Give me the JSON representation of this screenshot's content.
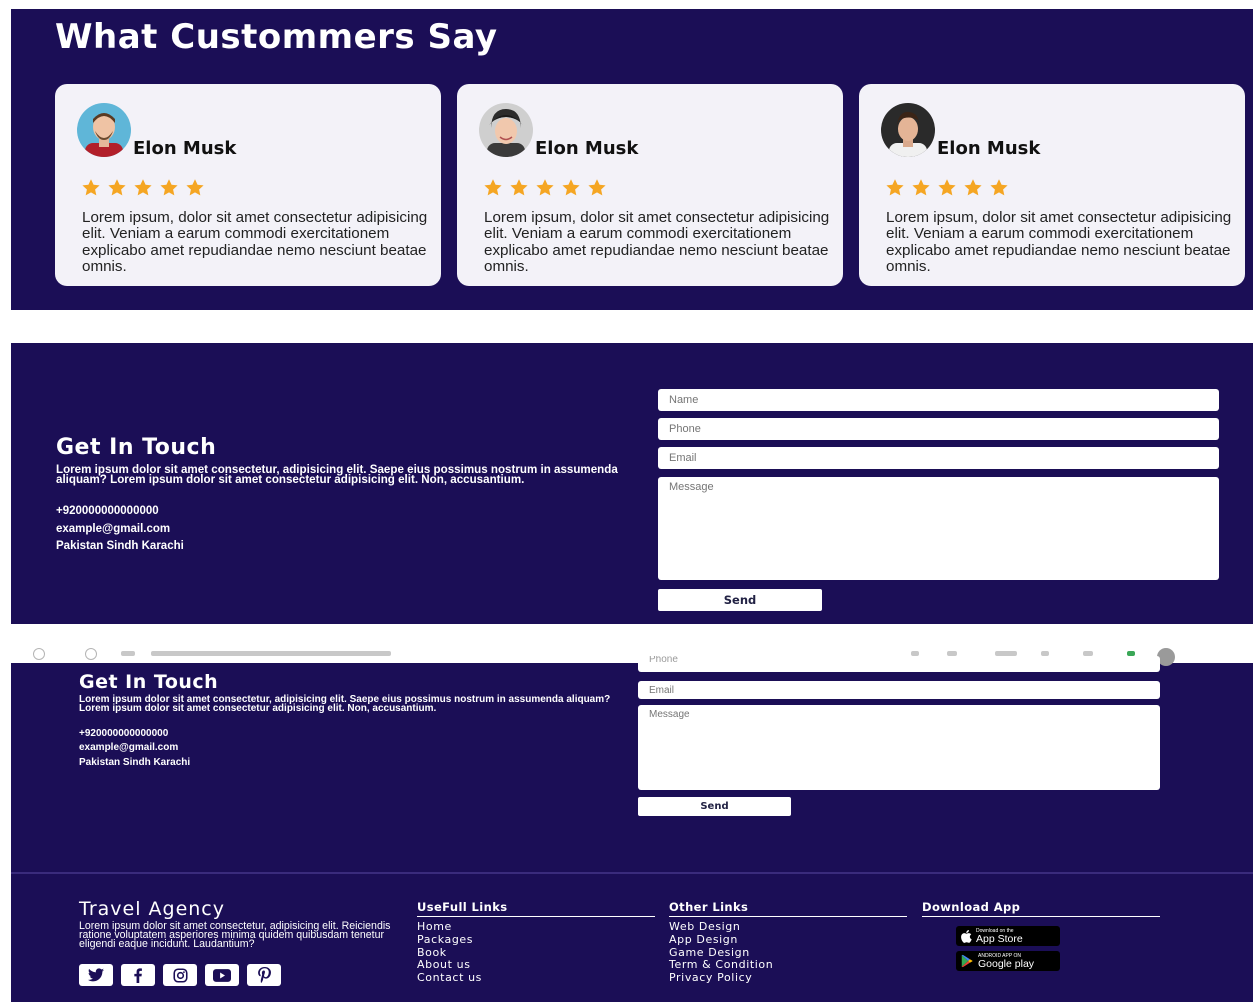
{
  "testimonials": {
    "title": "What Custommers Say",
    "cards": [
      {
        "name": "Elon Musk",
        "rating": 5,
        "text": "Lorem ipsum, dolor sit amet consectetur adipisicing elit. Veniam a earum commodi exercitationem explicabo amet repudiandae nemo nesciunt beatae omnis."
      },
      {
        "name": "Elon Musk",
        "rating": 5,
        "text": "Lorem ipsum, dolor sit amet consectetur adipisicing elit. Veniam a earum commodi exercitationem explicabo amet repudiandae nemo nesciunt beatae omnis."
      },
      {
        "name": "Elon Musk",
        "rating": 5,
        "text": "Lorem ipsum, dolor sit amet consectetur adipisicing elit. Veniam a earum commodi exercitationem explicabo amet repudiandae nemo nesciunt beatae omnis."
      }
    ]
  },
  "contact": {
    "title": "Get In Touch",
    "description": "Lorem ipsum dolor sit amet consectetur, adipisicing elit. Saepe eius possimus nostrum in assumenda aliquam? Lorem ipsum dolor sit amet consectetur adipisicing elit. Non, accusantium.",
    "phone": "+920000000000000",
    "email": "example@gmail.com",
    "address": "Pakistan Sindh Karachi",
    "form": {
      "name_placeholder": "Name",
      "phone_placeholder": "Phone",
      "email_placeholder": "Email",
      "message_placeholder": "Message",
      "send_label": "Send"
    }
  },
  "footer": {
    "brand": "Travel Agency",
    "description": "Lorem ipsum dolor sit amet consectetur, adipisicing elit. Reiciendis ratione voluptatem asperiores minima quidem quibusdam tenetur eligendi eaque incidunt. Laudantium?",
    "socials": [
      "twitter-icon",
      "facebook-icon",
      "instagram-icon",
      "youtube-icon",
      "pinterest-icon"
    ],
    "useful_links": {
      "title": "UseFull Links",
      "items": [
        "Home",
        "Packages",
        "Book",
        "About us",
        "Contact us"
      ]
    },
    "other_links": {
      "title": "Other Links",
      "items": [
        "Web Design",
        "App Design",
        "Game Design",
        "Term & Condition",
        "Privacy Policy"
      ]
    },
    "download": {
      "title": "Download App",
      "app_store": {
        "small": "Download on the",
        "big": "App Store"
      },
      "google_play": {
        "small": "ANDROID APP ON",
        "big": "Google play"
      }
    }
  },
  "colors": {
    "background": "#1b0e56",
    "card": "#f3f2f8",
    "star": "#f5a623",
    "text_light": "#ffffff"
  }
}
